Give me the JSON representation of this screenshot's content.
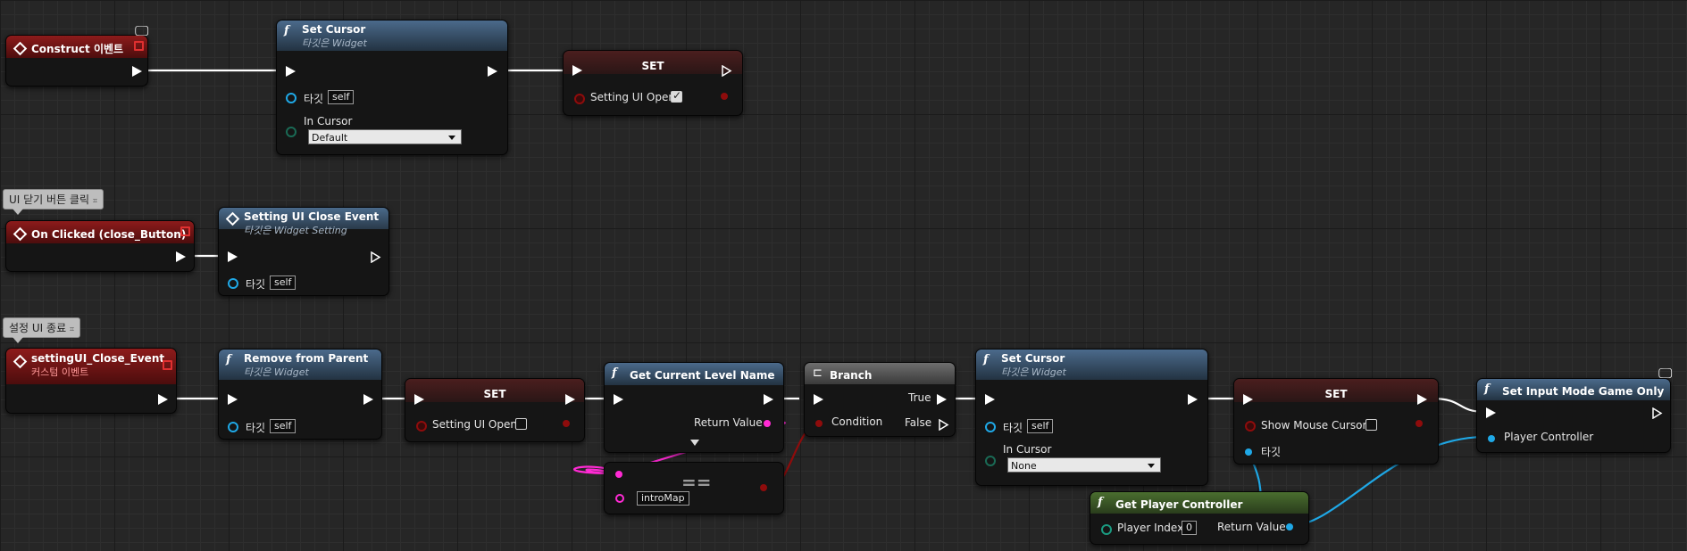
{
  "nodes": {
    "construct": {
      "title": "Construct 이벤트"
    },
    "setcursor1": {
      "title": "Set Cursor",
      "subtitle": "타깃은 Widget",
      "target_label": "타깃",
      "target_value": "self",
      "cursor_label": "In Cursor",
      "cursor_value": "Default"
    },
    "set1": {
      "title": "SET",
      "var_label": "Setting UI Open"
    },
    "onclicked": {
      "title": "On Clicked (close_Button)",
      "comment": "UI 닫기 버튼 클릭"
    },
    "closecall": {
      "title": "Setting UI Close Event",
      "subtitle": "타깃은 Widget Setting",
      "target_label": "타깃",
      "target_value": "self"
    },
    "customevent": {
      "title": "settingUI_Close_Event",
      "subtitle": "커스텀 이벤트",
      "comment": "설정 UI 종료"
    },
    "remove": {
      "title": "Remove from Parent",
      "subtitle": "타깃은 Widget",
      "target_label": "타깃",
      "target_value": "self"
    },
    "set2": {
      "title": "SET",
      "var_label": "Setting UI Open"
    },
    "getlevel": {
      "title": "Get Current Level Name",
      "return_label": "Return Value"
    },
    "equals": {
      "symbol": "==",
      "value": "introMap"
    },
    "branch": {
      "title": "Branch",
      "condition_label": "Condition",
      "true_label": "True",
      "false_label": "False"
    },
    "setcursor2": {
      "title": "Set Cursor",
      "subtitle": "타깃은 Widget",
      "target_label": "타깃",
      "target_value": "self",
      "cursor_label": "In Cursor",
      "cursor_value": "None"
    },
    "set3": {
      "title": "SET",
      "var_label": "Show Mouse Cursor",
      "target_label": "타깃"
    },
    "inputmode": {
      "title": "Set Input Mode Game Only",
      "pc_label": "Player Controller"
    },
    "getpc": {
      "title": "Get Player Controller",
      "index_label": "Player Index",
      "index_value": "0",
      "return_label": "Return Value"
    }
  },
  "colors": {
    "exec": "#ffffff",
    "bool": "#8e0c0c",
    "string": "#ff2ad4",
    "object": "#1fa8e6",
    "event_header": "#8d1b1b",
    "function_header": "#4b6a8b",
    "pure_header": "#4a6e2f"
  },
  "icons": {
    "function": "function-icon",
    "event": "event-diamond-icon",
    "branch": "branch-icon",
    "monitor": "monitor-icon"
  }
}
